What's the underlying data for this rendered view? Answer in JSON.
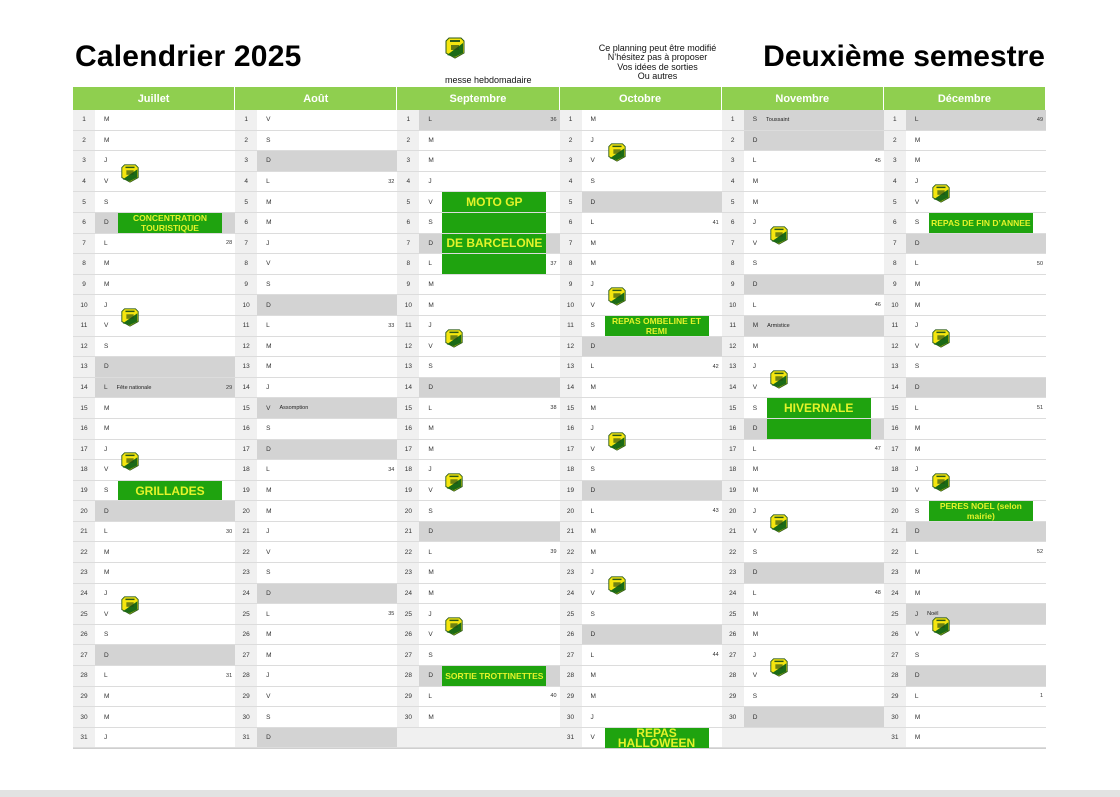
{
  "header": {
    "title_left": "Calendrier 2025",
    "title_right": "Deuxième semestre",
    "mass_label": "messe hebdomadaire",
    "note_lines": [
      "Ce planning peut être modifié",
      "N’hésitez pas à proposer",
      "Vos idées de sorties",
      "Ou autres"
    ],
    "logo_icon": "club-shield-logo"
  },
  "colors": {
    "month_header": "#8fcf4f",
    "event_bg": "#1fa30f",
    "event_text": "#e4f32a",
    "off_day": "#d3d3d3",
    "day_number_bg": "#f0f0f0"
  },
  "months": [
    {
      "name": "Juillet",
      "days": [
        {
          "d": "1",
          "w": "M"
        },
        {
          "d": "2",
          "w": "M"
        },
        {
          "d": "3",
          "w": "J"
        },
        {
          "d": "4",
          "w": "V",
          "logo": true
        },
        {
          "d": "5",
          "w": "S"
        },
        {
          "d": "6",
          "w": "D",
          "off": true
        },
        {
          "d": "7",
          "w": "L",
          "week": "28"
        },
        {
          "d": "8",
          "w": "M"
        },
        {
          "d": "9",
          "w": "M"
        },
        {
          "d": "10",
          "w": "J"
        },
        {
          "d": "11",
          "w": "V",
          "logo": true
        },
        {
          "d": "12",
          "w": "S"
        },
        {
          "d": "13",
          "w": "D",
          "off": true
        },
        {
          "d": "14",
          "w": "L",
          "off": true,
          "holiday": "Fête nationale",
          "week": "29"
        },
        {
          "d": "15",
          "w": "M"
        },
        {
          "d": "16",
          "w": "M"
        },
        {
          "d": "17",
          "w": "J"
        },
        {
          "d": "18",
          "w": "V",
          "logo": true
        },
        {
          "d": "19",
          "w": "S"
        },
        {
          "d": "20",
          "w": "D",
          "off": true
        },
        {
          "d": "21",
          "w": "L",
          "week": "30"
        },
        {
          "d": "22",
          "w": "M"
        },
        {
          "d": "23",
          "w": "M"
        },
        {
          "d": "24",
          "w": "J"
        },
        {
          "d": "25",
          "w": "V",
          "logo": true
        },
        {
          "d": "26",
          "w": "S"
        },
        {
          "d": "27",
          "w": "D",
          "off": true
        },
        {
          "d": "28",
          "w": "L",
          "week": "31"
        },
        {
          "d": "29",
          "w": "M"
        },
        {
          "d": "30",
          "w": "M"
        },
        {
          "d": "31",
          "w": "J"
        }
      ],
      "events": [
        {
          "label": "CONCENTRATION TOURISTIQUE",
          "start": 6,
          "span": 1
        },
        {
          "label": "GRILLADES",
          "start": 19,
          "span": 1
        }
      ]
    },
    {
      "name": "Août",
      "days": [
        {
          "d": "1",
          "w": "V"
        },
        {
          "d": "2",
          "w": "S"
        },
        {
          "d": "3",
          "w": "D",
          "off": true
        },
        {
          "d": "4",
          "w": "L",
          "week": "32"
        },
        {
          "d": "5",
          "w": "M"
        },
        {
          "d": "6",
          "w": "M"
        },
        {
          "d": "7",
          "w": "J"
        },
        {
          "d": "8",
          "w": "V"
        },
        {
          "d": "9",
          "w": "S"
        },
        {
          "d": "10",
          "w": "D",
          "off": true
        },
        {
          "d": "11",
          "w": "L",
          "week": "33"
        },
        {
          "d": "12",
          "w": "M"
        },
        {
          "d": "13",
          "w": "M"
        },
        {
          "d": "14",
          "w": "J"
        },
        {
          "d": "15",
          "w": "V",
          "off": true,
          "holiday": "Assomption"
        },
        {
          "d": "16",
          "w": "S"
        },
        {
          "d": "17",
          "w": "D",
          "off": true
        },
        {
          "d": "18",
          "w": "L",
          "week": "34"
        },
        {
          "d": "19",
          "w": "M"
        },
        {
          "d": "20",
          "w": "M"
        },
        {
          "d": "21",
          "w": "J"
        },
        {
          "d": "22",
          "w": "V"
        },
        {
          "d": "23",
          "w": "S"
        },
        {
          "d": "24",
          "w": "D",
          "off": true
        },
        {
          "d": "25",
          "w": "L",
          "week": "35"
        },
        {
          "d": "26",
          "w": "M"
        },
        {
          "d": "27",
          "w": "M"
        },
        {
          "d": "28",
          "w": "J"
        },
        {
          "d": "29",
          "w": "V"
        },
        {
          "d": "30",
          "w": "S"
        },
        {
          "d": "31",
          "w": "D",
          "off": true
        }
      ],
      "events": []
    },
    {
      "name": "Septembre",
      "days": [
        {
          "d": "1",
          "w": "L",
          "off": true,
          "week": "36"
        },
        {
          "d": "2",
          "w": "M"
        },
        {
          "d": "3",
          "w": "M"
        },
        {
          "d": "4",
          "w": "J"
        },
        {
          "d": "5",
          "w": "V"
        },
        {
          "d": "6",
          "w": "S"
        },
        {
          "d": "7",
          "w": "D",
          "off": true
        },
        {
          "d": "8",
          "w": "L",
          "week": "37"
        },
        {
          "d": "9",
          "w": "M"
        },
        {
          "d": "10",
          "w": "M"
        },
        {
          "d": "11",
          "w": "J"
        },
        {
          "d": "12",
          "w": "V",
          "logo": true
        },
        {
          "d": "13",
          "w": "S"
        },
        {
          "d": "14",
          "w": "D",
          "off": true
        },
        {
          "d": "15",
          "w": "L",
          "week": "38"
        },
        {
          "d": "16",
          "w": "M"
        },
        {
          "d": "17",
          "w": "M"
        },
        {
          "d": "18",
          "w": "J"
        },
        {
          "d": "19",
          "w": "V",
          "logo": true
        },
        {
          "d": "20",
          "w": "S"
        },
        {
          "d": "21",
          "w": "D",
          "off": true
        },
        {
          "d": "22",
          "w": "L",
          "week": "39"
        },
        {
          "d": "23",
          "w": "M"
        },
        {
          "d": "24",
          "w": "M"
        },
        {
          "d": "25",
          "w": "J"
        },
        {
          "d": "26",
          "w": "V",
          "logo": true
        },
        {
          "d": "27",
          "w": "S"
        },
        {
          "d": "28",
          "w": "D",
          "off": true
        },
        {
          "d": "29",
          "w": "L",
          "week": "40"
        },
        {
          "d": "30",
          "w": "M"
        },
        {
          "empty": true
        }
      ],
      "events": [
        {
          "label": "MOTO GP",
          "start": 5,
          "span": 1
        },
        {
          "label": "",
          "start": 6,
          "span": 1
        },
        {
          "label": "DE BARCELONE",
          "start": 7,
          "span": 1
        },
        {
          "label": "",
          "start": 8,
          "span": 1
        },
        {
          "label": "SORTIE TROTTINETTES",
          "start": 28,
          "span": 1
        }
      ]
    },
    {
      "name": "Octobre",
      "days": [
        {
          "d": "1",
          "w": "M"
        },
        {
          "d": "2",
          "w": "J"
        },
        {
          "d": "3",
          "w": "V",
          "logo": true
        },
        {
          "d": "4",
          "w": "S"
        },
        {
          "d": "5",
          "w": "D",
          "off": true
        },
        {
          "d": "6",
          "w": "L",
          "week": "41"
        },
        {
          "d": "7",
          "w": "M"
        },
        {
          "d": "8",
          "w": "M"
        },
        {
          "d": "9",
          "w": "J"
        },
        {
          "d": "10",
          "w": "V",
          "logo": true
        },
        {
          "d": "11",
          "w": "S"
        },
        {
          "d": "12",
          "w": "D",
          "off": true
        },
        {
          "d": "13",
          "w": "L",
          "week": "42"
        },
        {
          "d": "14",
          "w": "M"
        },
        {
          "d": "15",
          "w": "M"
        },
        {
          "d": "16",
          "w": "J"
        },
        {
          "d": "17",
          "w": "V",
          "logo": true
        },
        {
          "d": "18",
          "w": "S"
        },
        {
          "d": "19",
          "w": "D",
          "off": true
        },
        {
          "d": "20",
          "w": "L",
          "week": "43"
        },
        {
          "d": "21",
          "w": "M"
        },
        {
          "d": "22",
          "w": "M"
        },
        {
          "d": "23",
          "w": "J"
        },
        {
          "d": "24",
          "w": "V",
          "logo": true
        },
        {
          "d": "25",
          "w": "S"
        },
        {
          "d": "26",
          "w": "D",
          "off": true
        },
        {
          "d": "27",
          "w": "L",
          "week": "44"
        },
        {
          "d": "28",
          "w": "M"
        },
        {
          "d": "29",
          "w": "M"
        },
        {
          "d": "30",
          "w": "J"
        },
        {
          "d": "31",
          "w": "V"
        }
      ],
      "events": [
        {
          "label": "REPAS OMBELINE ET REMI",
          "start": 11,
          "span": 1
        },
        {
          "label": "REPAS HALLOWEEN",
          "start": 31,
          "span": 1
        }
      ]
    },
    {
      "name": "Novembre",
      "days": [
        {
          "d": "1",
          "w": "S",
          "off": true,
          "holiday": "Toussaint"
        },
        {
          "d": "2",
          "w": "D",
          "off": true
        },
        {
          "d": "3",
          "w": "L",
          "week": "45"
        },
        {
          "d": "4",
          "w": "M"
        },
        {
          "d": "5",
          "w": "M"
        },
        {
          "d": "6",
          "w": "J"
        },
        {
          "d": "7",
          "w": "V",
          "logo": true
        },
        {
          "d": "8",
          "w": "S"
        },
        {
          "d": "9",
          "w": "D",
          "off": true
        },
        {
          "d": "10",
          "w": "L",
          "week": "46"
        },
        {
          "d": "11",
          "w": "M",
          "off": true,
          "holiday": "Armistice"
        },
        {
          "d": "12",
          "w": "M"
        },
        {
          "d": "13",
          "w": "J"
        },
        {
          "d": "14",
          "w": "V",
          "logo": true
        },
        {
          "d": "15",
          "w": "S"
        },
        {
          "d": "16",
          "w": "D",
          "off": true
        },
        {
          "d": "17",
          "w": "L",
          "week": "47"
        },
        {
          "d": "18",
          "w": "M"
        },
        {
          "d": "19",
          "w": "M"
        },
        {
          "d": "20",
          "w": "J"
        },
        {
          "d": "21",
          "w": "V",
          "logo": true
        },
        {
          "d": "22",
          "w": "S"
        },
        {
          "d": "23",
          "w": "D",
          "off": true
        },
        {
          "d": "24",
          "w": "L",
          "week": "48"
        },
        {
          "d": "25",
          "w": "M"
        },
        {
          "d": "26",
          "w": "M"
        },
        {
          "d": "27",
          "w": "J"
        },
        {
          "d": "28",
          "w": "V",
          "logo": true
        },
        {
          "d": "29",
          "w": "S"
        },
        {
          "d": "30",
          "w": "D",
          "off": true
        },
        {
          "empty": true
        }
      ],
      "events": [
        {
          "label": "HIVERNALE",
          "start": 15,
          "span": 1
        },
        {
          "label": "",
          "start": 16,
          "span": 1
        }
      ]
    },
    {
      "name": "Décembre",
      "days": [
        {
          "d": "1",
          "w": "L",
          "off": true,
          "week": "49"
        },
        {
          "d": "2",
          "w": "M"
        },
        {
          "d": "3",
          "w": "M"
        },
        {
          "d": "4",
          "w": "J"
        },
        {
          "d": "5",
          "w": "V",
          "logo": true
        },
        {
          "d": "6",
          "w": "S"
        },
        {
          "d": "7",
          "w": "D",
          "off": true
        },
        {
          "d": "8",
          "w": "L",
          "week": "50"
        },
        {
          "d": "9",
          "w": "M"
        },
        {
          "d": "10",
          "w": "M"
        },
        {
          "d": "11",
          "w": "J"
        },
        {
          "d": "12",
          "w": "V",
          "logo": true
        },
        {
          "d": "13",
          "w": "S"
        },
        {
          "d": "14",
          "w": "D",
          "off": true
        },
        {
          "d": "15",
          "w": "L",
          "week": "51"
        },
        {
          "d": "16",
          "w": "M"
        },
        {
          "d": "17",
          "w": "M"
        },
        {
          "d": "18",
          "w": "J"
        },
        {
          "d": "19",
          "w": "V",
          "logo": true
        },
        {
          "d": "20",
          "w": "S"
        },
        {
          "d": "21",
          "w": "D",
          "off": true
        },
        {
          "d": "22",
          "w": "L",
          "week": "52"
        },
        {
          "d": "23",
          "w": "M"
        },
        {
          "d": "24",
          "w": "M"
        },
        {
          "d": "25",
          "w": "J",
          "off": true,
          "holiday": "Noël"
        },
        {
          "d": "26",
          "w": "V",
          "logo": true
        },
        {
          "d": "27",
          "w": "S"
        },
        {
          "d": "28",
          "w": "D",
          "off": true
        },
        {
          "d": "29",
          "w": "L",
          "week": "1"
        },
        {
          "d": "30",
          "w": "M"
        },
        {
          "d": "31",
          "w": "M"
        }
      ],
      "events": [
        {
          "label": "REPAS DE FIN D’ANNEE",
          "start": 6,
          "span": 1
        },
        {
          "label": "PERES NOEL (selon mairie)",
          "start": 20,
          "span": 1
        }
      ]
    }
  ]
}
